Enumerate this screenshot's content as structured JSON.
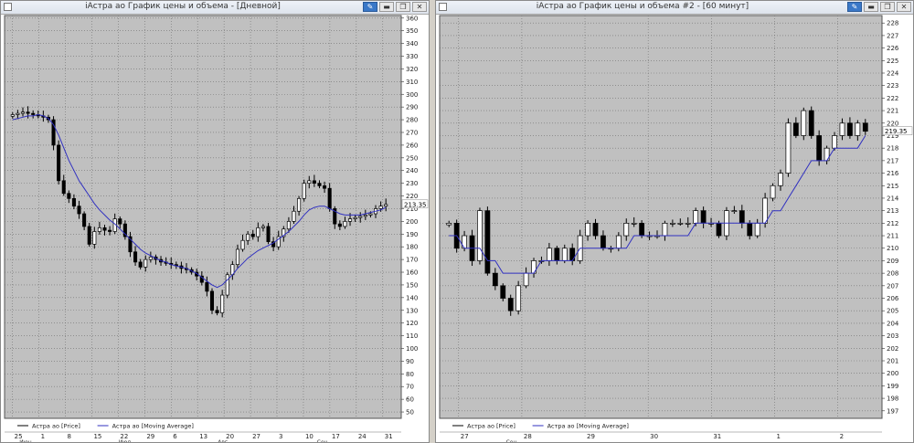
{
  "windows": [
    {
      "title": "iАстра ао График цены и объема - [Дневной]",
      "buttons": [
        "pin",
        "minimize",
        "restore",
        "close"
      ],
      "chart_data": {
        "type": "candlestick",
        "y_ticks": [
          50,
          60,
          70,
          80,
          90,
          100,
          110,
          120,
          130,
          140,
          150,
          160,
          170,
          180,
          190,
          200,
          210,
          220,
          230,
          240,
          250,
          260,
          270,
          280,
          290,
          300,
          310,
          320,
          330,
          340,
          350,
          360
        ],
        "ylim": [
          45,
          362
        ],
        "last_price_label": "213.35",
        "last_price": 213.35,
        "x_ticks": [
          "25",
          "1",
          "8",
          "15",
          "22",
          "29",
          "6",
          "13",
          "20",
          "27",
          "3",
          "10",
          "17",
          "24",
          "31"
        ],
        "x_ticks_lower": [
          "Июн",
          "Июл",
          "Авг",
          "Сен"
        ],
        "legend": [
          {
            "name": "Астра ао [Price]",
            "color": "#000000"
          },
          {
            "name": "Астра ао [Moving Average]",
            "color": "#3030c0"
          }
        ],
        "close": [
          284,
          285,
          286,
          285,
          284,
          283,
          282,
          280,
          260,
          232,
          222,
          218,
          212,
          206,
          196,
          182,
          192,
          195,
          193,
          192,
          202,
          198,
          188,
          176,
          168,
          164,
          170,
          172,
          170,
          168,
          167,
          166,
          165,
          163,
          162,
          160,
          157,
          152,
          145,
          130,
          128,
          142,
          158,
          166,
          178,
          185,
          190,
          188,
          195,
          196,
          184,
          180,
          188,
          194,
          200,
          208,
          218,
          230,
          232,
          230,
          228,
          226,
          210,
          198,
          196,
          200,
          202,
          203,
          204,
          205,
          206,
          210,
          212,
          213.35
        ],
        "moving_average": [
          280,
          281,
          282,
          283,
          283,
          284,
          283,
          281,
          276,
          268,
          258,
          248,
          240,
          232,
          226,
          220,
          214,
          209,
          205,
          201,
          198,
          194,
          190,
          186,
          182,
          178,
          175,
          173,
          171,
          169,
          168,
          166,
          165,
          164,
          163,
          161,
          159,
          156,
          153,
          150,
          148,
          150,
          154,
          158,
          163,
          167,
          171,
          174,
          177,
          179,
          181,
          183,
          186,
          189,
          192,
          196,
          200,
          205,
          209,
          211,
          212,
          212,
          210,
          208,
          206,
          205,
          205,
          205,
          205,
          206,
          207,
          208,
          209,
          211
        ]
      }
    },
    {
      "title": "iАстра ао График цены и объема #2 - [60 минут]",
      "buttons": [
        "pin",
        "minimize",
        "restore",
        "close"
      ],
      "chart_data": {
        "type": "candlestick",
        "y_ticks": [
          197,
          198,
          199,
          200,
          201,
          202,
          203,
          204,
          205,
          206,
          207,
          208,
          209,
          210,
          211,
          212,
          213,
          214,
          215,
          216,
          217,
          218,
          219,
          220,
          221,
          222,
          223,
          224,
          225,
          226,
          227,
          228
        ],
        "ylim": [
          196.4,
          228.6
        ],
        "last_price_label": "219.35",
        "last_price": 219.35,
        "x_ticks": [
          "27",
          "28",
          "29",
          "30",
          "31",
          "1",
          "2"
        ],
        "x_ticks_lower": [
          "Сен"
        ],
        "legend": [
          {
            "name": "Астра ао [Price]",
            "color": "#000000"
          },
          {
            "name": "Астра ао [Moving Average]",
            "color": "#3030c0"
          }
        ],
        "close": [
          212,
          210,
          211,
          209,
          213,
          208,
          207,
          206,
          205,
          207,
          208,
          209,
          209,
          210,
          209,
          210,
          209,
          211,
          212,
          211,
          210,
          210,
          211,
          212,
          212,
          211,
          211,
          211,
          212,
          212,
          212,
          212,
          213,
          212,
          212,
          211,
          213,
          213,
          212,
          211,
          212,
          214,
          215,
          216,
          220,
          219,
          221,
          219,
          217,
          218,
          219,
          220,
          219,
          220,
          219.35
        ],
        "moving_average": [
          211,
          211,
          210,
          210,
          210,
          209,
          209,
          208,
          208,
          208,
          208,
          208,
          209,
          209,
          209,
          209,
          209,
          210,
          210,
          210,
          210,
          210,
          210,
          210,
          211,
          211,
          211,
          211,
          211,
          211,
          211,
          211,
          212,
          212,
          212,
          212,
          212,
          212,
          212,
          212,
          212,
          212,
          213,
          213,
          214,
          215,
          216,
          217,
          217,
          217,
          218,
          218,
          218,
          218,
          219
        ]
      }
    }
  ]
}
